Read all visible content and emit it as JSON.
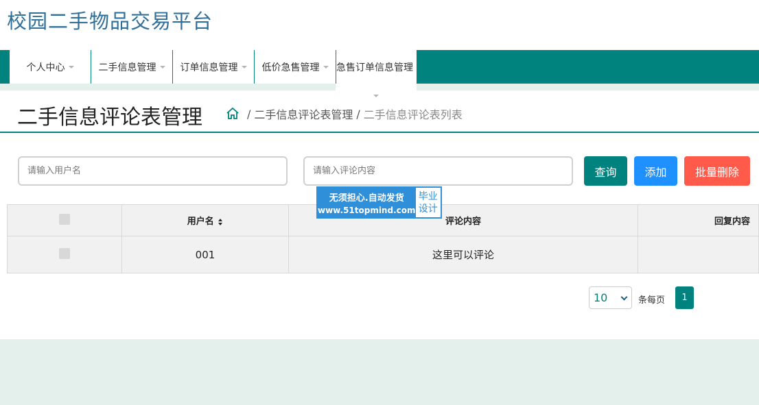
{
  "site": {
    "title": "校园二手物品交易平台"
  },
  "nav": {
    "items": [
      {
        "label": "个人中心"
      },
      {
        "label": "二手信息管理"
      },
      {
        "label": "订单信息管理"
      },
      {
        "label": "低价急售管理"
      },
      {
        "label": "急售订单信息管理"
      }
    ]
  },
  "header": {
    "page_title": "二手信息评论表管理",
    "breadcrumb": [
      "二手信息评论表管理",
      "二手信息评论表列表"
    ]
  },
  "search": {
    "username_placeholder": "请输入用户名",
    "comment_placeholder": "请输入评论内容",
    "query_label": "查询",
    "add_label": "添加",
    "delete_label": "批量删除"
  },
  "watermark": {
    "line1": "无须担心.自动发货",
    "line2": "www.51topmind.com",
    "badge1": "毕业",
    "badge2": "设计"
  },
  "table": {
    "headers": {
      "username": "用户名",
      "comment": "评论内容",
      "reply": "回复内容"
    },
    "rows": [
      {
        "username": "001",
        "comment": "这里可以评论",
        "reply": ""
      }
    ]
  },
  "pagination": {
    "per_page": "10",
    "per_page_label": "条每页",
    "current_page": "1"
  },
  "colors": {
    "primary": "#00827f",
    "add": "#1e90ff",
    "delete": "#ff5a4a",
    "title": "#2f6f9a"
  }
}
